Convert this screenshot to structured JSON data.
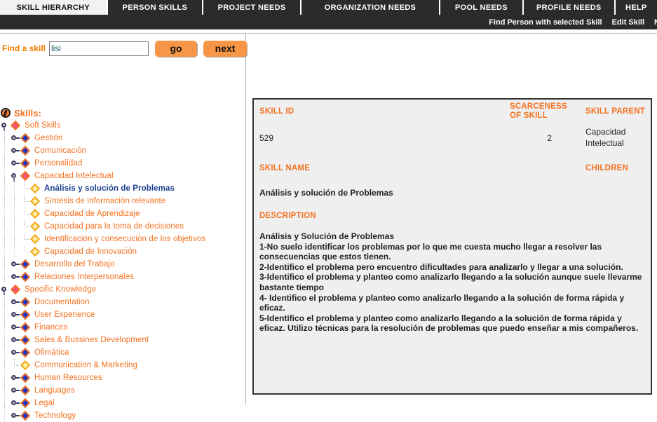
{
  "tabs": [
    {
      "label": "SKILL HIERARCHY",
      "active": true
    },
    {
      "label": "PERSON SKILLS",
      "active": false
    },
    {
      "label": "PROJECT NEEDS",
      "active": false
    },
    {
      "label": "ORGANIZATION NEEDS",
      "active": false
    },
    {
      "label": "POOL NEEDS",
      "active": false
    },
    {
      "label": "PROFILE NEEDS",
      "active": false
    },
    {
      "label": "HELP",
      "active": false
    }
  ],
  "actionbar": {
    "find_person": "Find Person with selected Skill",
    "edit_skill": "Edit Skill",
    "new_skill": "N"
  },
  "search": {
    "label": "Find a skill",
    "value": "lisi",
    "placeholder": "",
    "go_label": "go",
    "next_label": "next"
  },
  "tree": {
    "root_label": "Skills:",
    "items": [
      {
        "label": "Soft Skills",
        "depth": 0,
        "icon": "pink-diamond-icon",
        "knob": "minus",
        "selected": false
      },
      {
        "label": "Gestión",
        "depth": 1,
        "icon": "blue-diamond-icon",
        "knob": "plus",
        "selected": false
      },
      {
        "label": "Comunicación",
        "depth": 1,
        "icon": "blue-diamond-icon",
        "knob": "plus",
        "selected": false
      },
      {
        "label": "Personalidad",
        "depth": 1,
        "icon": "blue-diamond-icon",
        "knob": "plus",
        "selected": false
      },
      {
        "label": "Capacidad Intelectual",
        "depth": 1,
        "icon": "pink-diamond-icon",
        "knob": "minus",
        "selected": false
      },
      {
        "label": "Análisis y solución de Problemas",
        "depth": 2,
        "icon": "yellow-diamond-icon",
        "knob": "none",
        "selected": true
      },
      {
        "label": "Síntesis de información relevante",
        "depth": 2,
        "icon": "yellow-diamond-icon",
        "knob": "none",
        "selected": false
      },
      {
        "label": "Capacidad de Aprendizaje",
        "depth": 2,
        "icon": "yellow-diamond-icon",
        "knob": "none",
        "selected": false
      },
      {
        "label": "Capacidad para la toma de decisiones",
        "depth": 2,
        "icon": "yellow-diamond-icon",
        "knob": "none",
        "selected": false
      },
      {
        "label": "Identificación y consecución de los objetivos",
        "depth": 2,
        "icon": "yellow-diamond-icon",
        "knob": "none",
        "selected": false
      },
      {
        "label": "Capacidad de Innovación",
        "depth": 2,
        "icon": "yellow-diamond-icon",
        "knob": "none",
        "selected": false
      },
      {
        "label": "Desarrollo del Trabajo",
        "depth": 1,
        "icon": "blue-diamond-icon",
        "knob": "plus",
        "selected": false
      },
      {
        "label": "Relaciones Interpersonales",
        "depth": 1,
        "icon": "blue-diamond-icon",
        "knob": "plus",
        "selected": false
      },
      {
        "label": "Specific Knowledge",
        "depth": 0,
        "icon": "pink-diamond-icon",
        "knob": "minus",
        "selected": false
      },
      {
        "label": "Documentation",
        "depth": 1,
        "icon": "blue-diamond-icon",
        "knob": "plus",
        "selected": false
      },
      {
        "label": "User Experience",
        "depth": 1,
        "icon": "blue-diamond-icon",
        "knob": "plus",
        "selected": false
      },
      {
        "label": "Finances",
        "depth": 1,
        "icon": "blue-diamond-icon",
        "knob": "plus",
        "selected": false
      },
      {
        "label": "Sales & Bussines Development",
        "depth": 1,
        "icon": "blue-diamond-icon",
        "knob": "plus",
        "selected": false
      },
      {
        "label": "Ofimática",
        "depth": 1,
        "icon": "blue-diamond-icon",
        "knob": "plus",
        "selected": false
      },
      {
        "label": "Communication & Marketing",
        "depth": 1,
        "icon": "yellow-diamond-icon",
        "knob": "none",
        "selected": false
      },
      {
        "label": "Human Resources",
        "depth": 1,
        "icon": "blue-diamond-icon",
        "knob": "plus",
        "selected": false
      },
      {
        "label": "Languages",
        "depth": 1,
        "icon": "blue-diamond-icon",
        "knob": "plus",
        "selected": false
      },
      {
        "label": "Legal",
        "depth": 1,
        "icon": "blue-diamond-icon",
        "knob": "plus",
        "selected": false
      },
      {
        "label": "Technology",
        "depth": 1,
        "icon": "blue-diamond-icon",
        "knob": "plus",
        "selected": false
      }
    ]
  },
  "detail": {
    "skill_id_label": "SKILL ID",
    "skill_id_value": "529",
    "scarceness_label": "SCARCENESS OF SKILL",
    "scarceness_value": "2",
    "skill_parent_label": "SKILL PARENT",
    "skill_parent_value": "Capacidad Intelectual",
    "skill_name_label": "SKILL NAME",
    "skill_name_value": "Análisis y solución de Problemas",
    "children_label": "CHILDREN",
    "children_value": "",
    "description_label": "DESCRIPTION",
    "description_value": "Análisis y Solución de Problemas\n1-No suelo identificar los problemas por lo que me cuesta mucho llegar a resolver las consecuencias que estos tienen.\n2-Identifico el problema pero encuentro dificultades para analizarlo y llegar a una solución.\n3-Identifico el problema y planteo como analizarlo llegando a la solución aunque suele llevarme bastante tiempo\n4- Identifico el problema y planteo como analizarlo llegando a la solución de forma rápida y eficaz.\n5-Identifico el problema y planteo como analizarlo llegando a la solución de forma rápida y eficaz. Utilizo técnicas para la resolución de problemas que puedo enseñar a mis compañeros."
  },
  "colors": {
    "accent_orange": "#f4711f",
    "button_orange": "#f79646",
    "tab_dark": "#2b2b2b",
    "panel_bg": "#efefef",
    "selected_blue": "#1b3f8f"
  }
}
